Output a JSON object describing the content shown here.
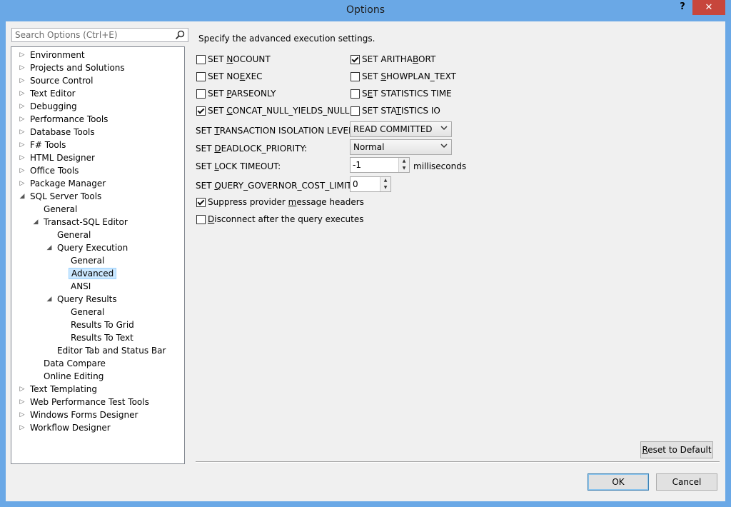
{
  "window": {
    "title": "Options",
    "help": "?",
    "close": "✕"
  },
  "search": {
    "placeholder": "Search Options (Ctrl+E)",
    "value": ""
  },
  "tree": [
    {
      "label": "Environment",
      "level": 0,
      "arrow": "collapsed"
    },
    {
      "label": "Projects and Solutions",
      "level": 0,
      "arrow": "collapsed"
    },
    {
      "label": "Source Control",
      "level": 0,
      "arrow": "collapsed"
    },
    {
      "label": "Text Editor",
      "level": 0,
      "arrow": "collapsed"
    },
    {
      "label": "Debugging",
      "level": 0,
      "arrow": "collapsed"
    },
    {
      "label": "Performance Tools",
      "level": 0,
      "arrow": "collapsed"
    },
    {
      "label": "Database Tools",
      "level": 0,
      "arrow": "collapsed"
    },
    {
      "label": "F# Tools",
      "level": 0,
      "arrow": "collapsed"
    },
    {
      "label": "HTML Designer",
      "level": 0,
      "arrow": "collapsed"
    },
    {
      "label": "Office Tools",
      "level": 0,
      "arrow": "collapsed"
    },
    {
      "label": "Package Manager",
      "level": 0,
      "arrow": "collapsed"
    },
    {
      "label": "SQL Server Tools",
      "level": 0,
      "arrow": "expanded"
    },
    {
      "label": "General",
      "level": 1,
      "arrow": "none"
    },
    {
      "label": "Transact-SQL Editor",
      "level": 1,
      "arrow": "expanded"
    },
    {
      "label": "General",
      "level": 2,
      "arrow": "none"
    },
    {
      "label": "Query Execution",
      "level": 2,
      "arrow": "expanded"
    },
    {
      "label": "General",
      "level": 3,
      "arrow": "none"
    },
    {
      "label": "Advanced",
      "level": 3,
      "arrow": "none",
      "selected": true
    },
    {
      "label": "ANSI",
      "level": 3,
      "arrow": "none"
    },
    {
      "label": "Query Results",
      "level": 2,
      "arrow": "expanded"
    },
    {
      "label": "General",
      "level": 3,
      "arrow": "none"
    },
    {
      "label": "Results To Grid",
      "level": 3,
      "arrow": "none"
    },
    {
      "label": "Results To Text",
      "level": 3,
      "arrow": "none"
    },
    {
      "label": "Editor Tab and Status Bar",
      "level": 2,
      "arrow": "none"
    },
    {
      "label": "Data Compare",
      "level": 1,
      "arrow": "none"
    },
    {
      "label": "Online Editing",
      "level": 1,
      "arrow": "none"
    },
    {
      "label": "Text Templating",
      "level": 0,
      "arrow": "collapsed"
    },
    {
      "label": "Web Performance Test Tools",
      "level": 0,
      "arrow": "collapsed"
    },
    {
      "label": "Windows Forms Designer",
      "level": 0,
      "arrow": "collapsed"
    },
    {
      "label": "Workflow Designer",
      "level": 0,
      "arrow": "collapsed"
    }
  ],
  "settings": {
    "description": "Specify the advanced execution settings.",
    "checkboxes_left": [
      {
        "pre": "SET ",
        "key": "N",
        "post": "OCOUNT",
        "checked": false
      },
      {
        "pre": "SET NO",
        "key": "E",
        "post": "XEC",
        "checked": false
      },
      {
        "pre": "SET ",
        "key": "P",
        "post": "ARSEONLY",
        "checked": false
      },
      {
        "pre": "SET ",
        "key": "C",
        "post": "ONCAT_NULL_YIELDS_NULL",
        "checked": true
      }
    ],
    "checkboxes_right": [
      {
        "pre": "SET ARITHA",
        "key": "B",
        "post": "ORT",
        "checked": true
      },
      {
        "pre": "SET ",
        "key": "S",
        "post": "HOWPLAN_TEXT",
        "checked": false
      },
      {
        "pre": "S",
        "key": "E",
        "post": "T STATISTICS TIME",
        "checked": false
      },
      {
        "pre": "SET STA",
        "key": "T",
        "post": "ISTICS IO",
        "checked": false
      }
    ],
    "isolation": {
      "pre": "SET ",
      "key": "T",
      "post": "RANSACTION ISOLATION LEVEL:",
      "value": "READ COMMITTED"
    },
    "deadlock": {
      "pre": "SET ",
      "key": "D",
      "post": "EADLOCK_PRIORITY:",
      "value": "Normal"
    },
    "lock_timeout": {
      "pre": "SET ",
      "key": "L",
      "post": "OCK TIMEOUT:",
      "value": "-1",
      "unit": "milliseconds"
    },
    "governor": {
      "pre": "SET ",
      "key": "Q",
      "post": "UERY_GOVERNOR_COST_LIMIT:",
      "value": "0"
    },
    "suppress": {
      "pre": "Suppress provider ",
      "key": "m",
      "post": "essage headers",
      "checked": true
    },
    "disconnect": {
      "pre": "",
      "key": "D",
      "post": "isconnect after the query executes",
      "checked": false
    }
  },
  "buttons": {
    "reset_pre": "",
    "reset_key": "R",
    "reset_post": "eset to Default",
    "ok": "OK",
    "cancel": "Cancel"
  }
}
